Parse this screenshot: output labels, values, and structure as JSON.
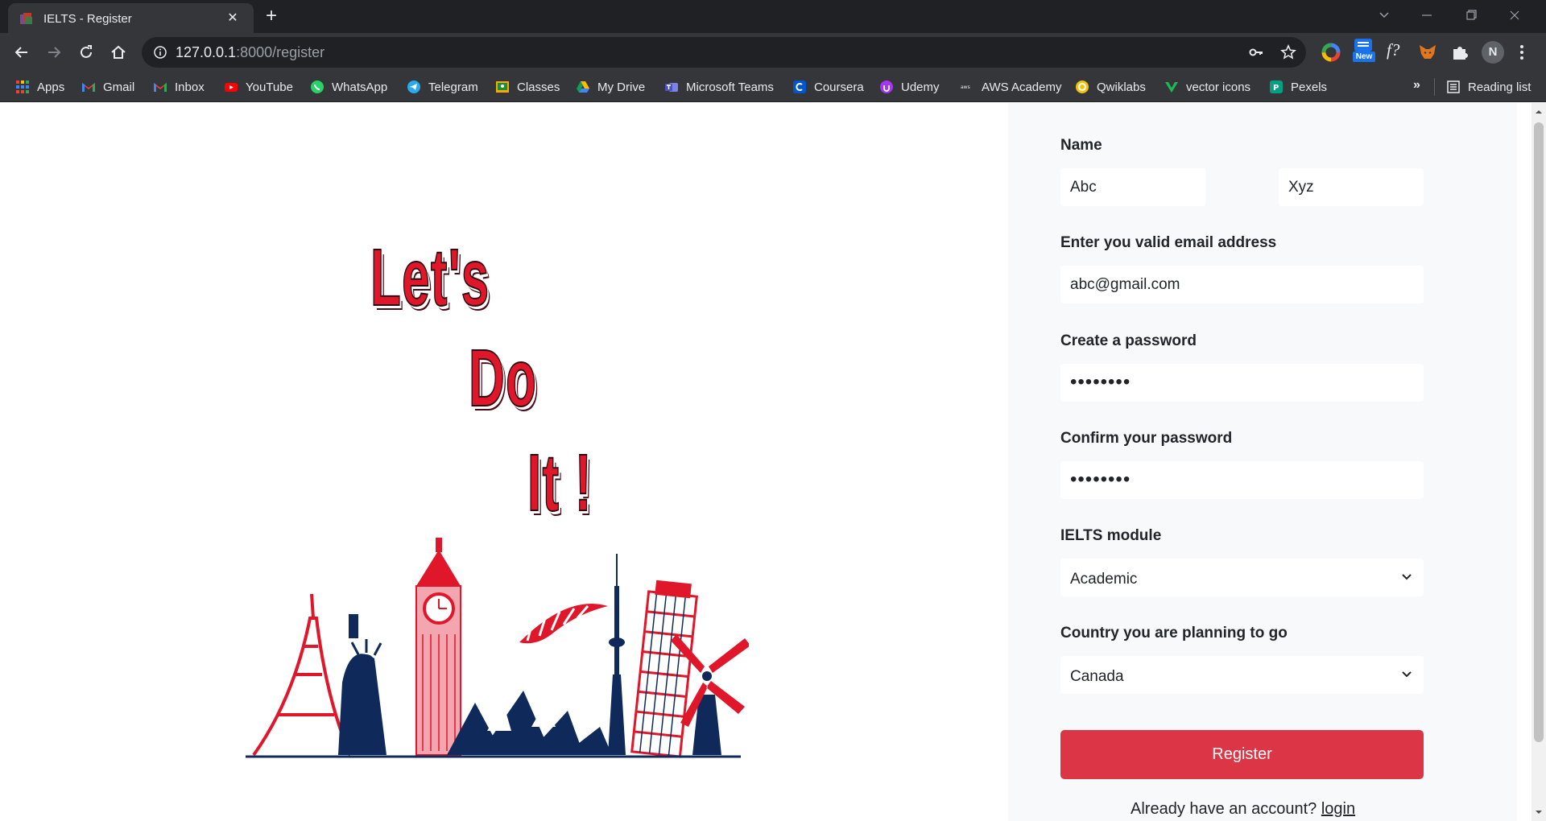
{
  "browser": {
    "tab_title": "IELTS - Register",
    "url_host": "127.0.0.1",
    "url_path": ":8000/register",
    "extension_badge": "New",
    "profile_initial": "N",
    "formula_ext_label": "f?"
  },
  "bookmarks": {
    "items": [
      {
        "label": "Apps",
        "icon": "apps-grid-icon"
      },
      {
        "label": "Gmail",
        "icon": "gmail-icon"
      },
      {
        "label": "Inbox",
        "icon": "inbox-icon"
      },
      {
        "label": "YouTube",
        "icon": "youtube-icon"
      },
      {
        "label": "WhatsApp",
        "icon": "whatsapp-icon"
      },
      {
        "label": "Telegram",
        "icon": "telegram-icon"
      },
      {
        "label": "Classes",
        "icon": "classroom-icon"
      },
      {
        "label": "My Drive",
        "icon": "drive-icon"
      },
      {
        "label": "Microsoft Teams",
        "icon": "teams-icon"
      },
      {
        "label": "Coursera",
        "icon": "coursera-icon"
      },
      {
        "label": "Udemy",
        "icon": "udemy-icon"
      },
      {
        "label": "AWS Academy",
        "icon": "aws-icon"
      },
      {
        "label": "Qwiklabs",
        "icon": "qwiklabs-icon"
      },
      {
        "label": "vector icons",
        "icon": "vector-icon"
      },
      {
        "label": "Pexels",
        "icon": "pexels-icon"
      }
    ],
    "overflow": "»",
    "reading_list": "Reading list"
  },
  "hero": {
    "line1": "Let's",
    "line2": "Do",
    "line3": "It !",
    "accent_color": "#e0162b",
    "navy_color": "#0f2a5a"
  },
  "form": {
    "name_label": "Name",
    "first_name": "Abc",
    "last_name": "Xyz",
    "email_label": "Enter you valid email address",
    "email_value": "abc@gmail.com",
    "password_label": "Create a password",
    "password_mask": "••••••••",
    "confirm_label": "Confirm your password",
    "confirm_mask": "••••••••",
    "module_label": "IELTS module",
    "module_value": "Academic",
    "country_label": "Country you are planning to go",
    "country_value": "Canada",
    "register_button": "Register",
    "have_account_text": "Already have an account?",
    "login_link": "login",
    "button_color": "#dc3545"
  }
}
